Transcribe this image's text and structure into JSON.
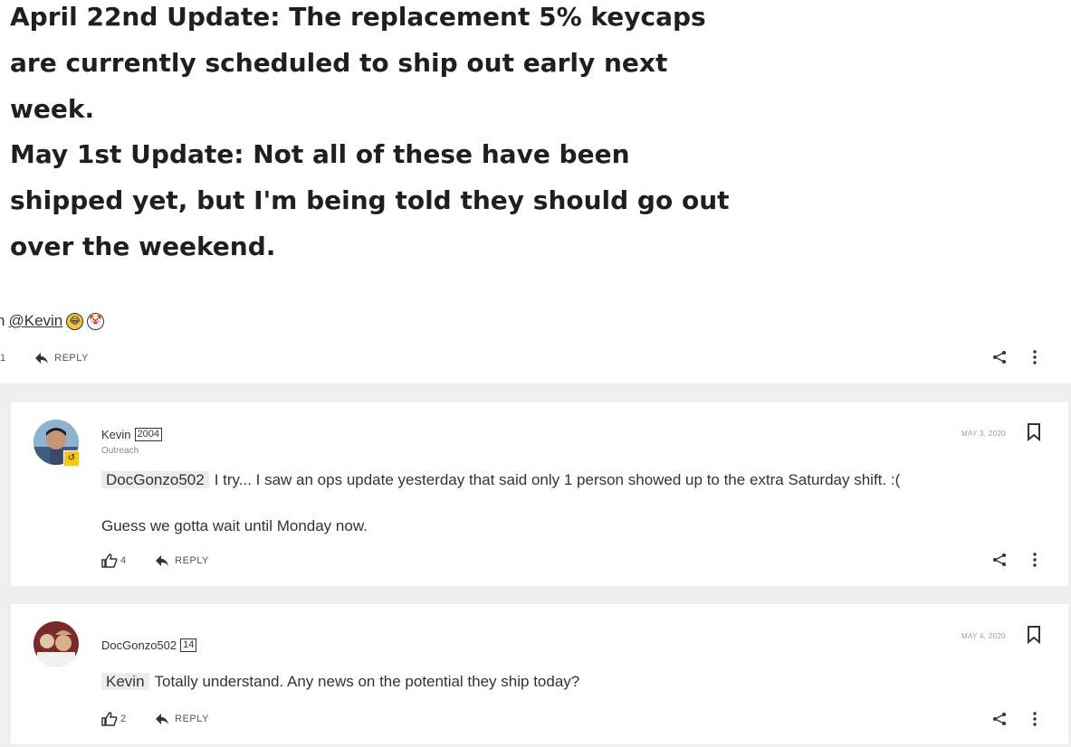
{
  "post": {
    "update1": "April 22nd Update: The replacement 5% keycaps are currently scheduled to ship out early next week.",
    "update2": "May 1st Update: Not all of these have been shipped yet, but I'm being told they should go out over the weekend.",
    "mention_prefix": "n",
    "mention_link": "@Kevin",
    "emoji1": "rolling-on-floor-laughing-emoji",
    "emoji2": "clown-face-emoji",
    "like_count": "1",
    "reply_label": "REPLY"
  },
  "comments": [
    {
      "author": "Kevin",
      "score": "2004",
      "role": "Outreach",
      "date": "MAY 3, 2020",
      "mention": "DocGonzo502",
      "text1": "I try... I saw an ops update yesterday that said only 1 person showed up to the extra Saturday shift. :(",
      "text2": "Guess we gotta wait until Monday now.",
      "likes": "4",
      "reply_label": "REPLY"
    },
    {
      "author": "DocGonzo502",
      "score": "14",
      "date": "MAY 4, 2020",
      "mention": "Kevin",
      "text1": "Totally understand. Any news on the potential they ship today?",
      "likes": "2",
      "reply_label": "REPLY"
    }
  ],
  "icons": {
    "reply": "reply-arrow-icon",
    "like": "thumbs-up-icon",
    "share": "share-icon",
    "more": "more-vertical-icon",
    "bookmark": "bookmark-icon"
  },
  "colors": {
    "gray_band": "#efefef",
    "badge": "#f5c518"
  }
}
